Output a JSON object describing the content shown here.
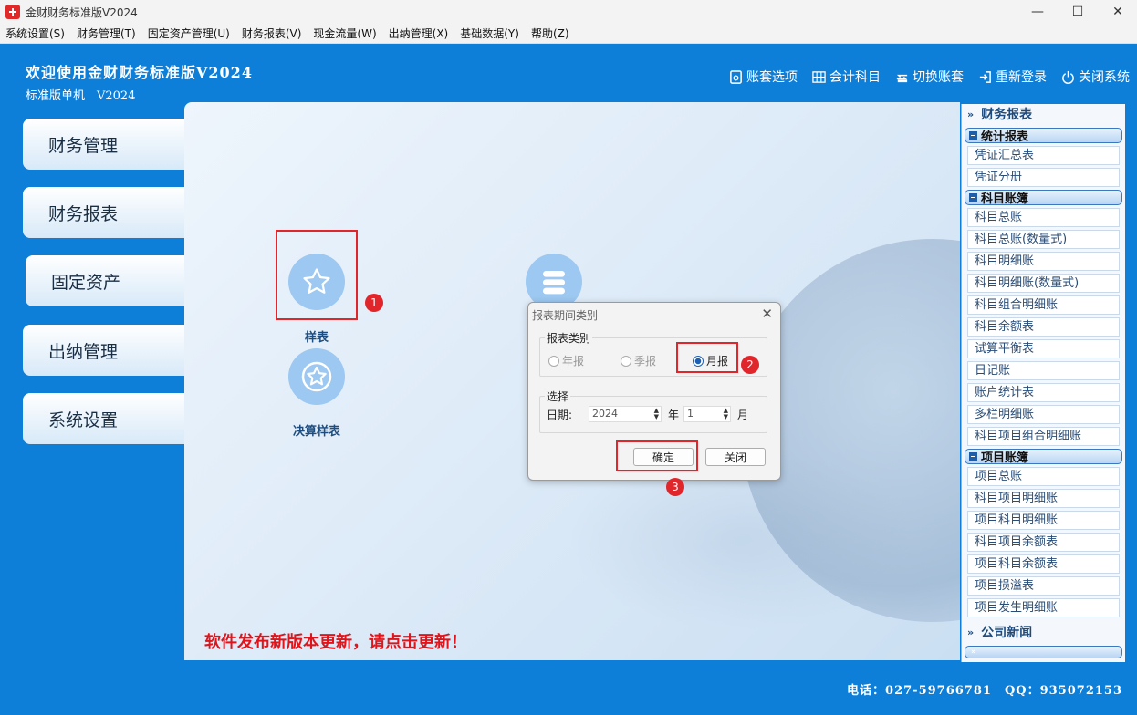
{
  "window": {
    "title": "金财财务标准版V2024",
    "minimize": "—",
    "maximize": "☐",
    "close": "✕"
  },
  "menu": [
    "系统设置(S)",
    "财务管理(T)",
    "固定资产管理(U)",
    "财务报表(V)",
    "现金流量(W)",
    "出纳管理(X)",
    "基础数据(Y)",
    "帮助(Z)"
  ],
  "header": {
    "welcome": "欢迎使用金财财务标准版V2024",
    "edition": "标准版单机　V2024"
  },
  "toolbar": {
    "account_options": "账套选项",
    "subjects": "会计科目",
    "switch_account": "切换账套",
    "relogin": "重新登录",
    "exit": "关闭系统"
  },
  "nav": [
    "财务管理",
    "财务报表",
    "固定资产",
    "出纳管理",
    "系统设置"
  ],
  "main": {
    "sample_table": "样表",
    "final_sample": "决算样表",
    "badge1": "1",
    "badge2": "2",
    "badge3": "3",
    "update_notice": "软件发布新版本更新，请点击更新！"
  },
  "dialog": {
    "title": "报表期间类别",
    "close_icon": "✕",
    "type_legend": "报表类别",
    "annual": "年报",
    "quarterly": "季报",
    "monthly": "月报",
    "select_legend": "选择",
    "date_label": "日期:",
    "year_value": "2024",
    "year_unit": "年",
    "month_value": "1",
    "month_unit": "月",
    "ok": "确定",
    "close_btn": "关闭"
  },
  "right_panel": {
    "header": "财务报表",
    "sections": [
      {
        "title": "统计报表",
        "items": [
          "凭证汇总表",
          "凭证分册"
        ]
      },
      {
        "title": "科目账簿",
        "items": [
          "科目总账",
          "科目总账(数量式)",
          "科目明细账",
          "科目明细账(数量式)",
          "科目组合明细账",
          "科目余额表",
          "试算平衡表",
          "日记账",
          "账户统计表",
          "多栏明细账",
          "科目项目组合明细账"
        ]
      },
      {
        "title": "项目账簿",
        "items": [
          "项目总账",
          "科目项目明细账",
          "项目科目明细账",
          "科目项目余额表",
          "项目科目余额表",
          "项目损溢表",
          "项目发生明细账"
        ]
      }
    ],
    "news_header": "公司新闻"
  },
  "footer": {
    "phone": "电话：027-59766781　QQ：935072153"
  },
  "colors": {
    "background": "#0d7fd8",
    "highlight": "#e0262b",
    "update_text": "#e0151b"
  }
}
